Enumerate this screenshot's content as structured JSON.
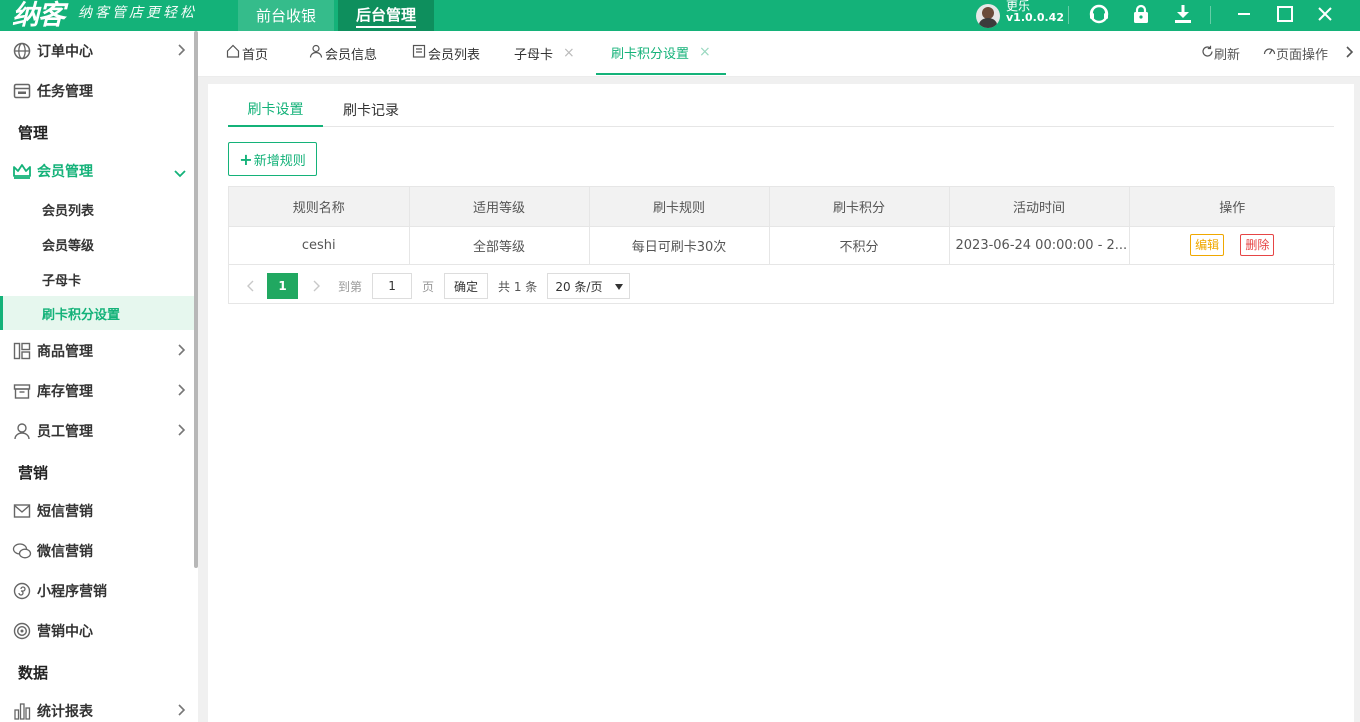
{
  "app": {
    "logo_text": "纳客",
    "slogan": "纳客管店更轻松",
    "top_nav": [
      {
        "label": "前台收银"
      },
      {
        "label": "后台管理"
      }
    ],
    "user": {
      "name": "更乐",
      "version": "v1.0.0.42"
    }
  },
  "sidebar": {
    "items": [
      {
        "label": "订单中心",
        "icon": "globe-icon"
      },
      {
        "label": "任务管理",
        "icon": "task-icon"
      },
      {
        "group": "管理"
      },
      {
        "label": "会员管理",
        "icon": "crown-icon"
      },
      {
        "label": "商品管理",
        "icon": "product-icon"
      },
      {
        "label": "库存管理",
        "icon": "inventory-icon"
      },
      {
        "label": "员工管理",
        "icon": "user-icon"
      },
      {
        "group": "营销"
      },
      {
        "label": "短信营销",
        "icon": "mail-icon"
      },
      {
        "label": "微信营销",
        "icon": "wechat-icon"
      },
      {
        "label": "小程序营销",
        "icon": "miniapp-icon"
      },
      {
        "label": "营销中心",
        "icon": "target-icon"
      },
      {
        "group": "数据"
      },
      {
        "label": "统计报表",
        "icon": "chart-icon"
      }
    ],
    "member_sub": [
      "会员列表",
      "会员等级",
      "子母卡",
      "刷卡积分设置"
    ]
  },
  "tabs": [
    {
      "label": "首页"
    },
    {
      "label": "会员信息"
    },
    {
      "label": "会员列表"
    },
    {
      "label": "子母卡"
    },
    {
      "label": "刷卡积分设置"
    }
  ],
  "tab_tools": {
    "refresh": "刷新",
    "page_ops": "页面操作"
  },
  "subtabs": [
    "刷卡设置",
    "刷卡记录"
  ],
  "add_button": "新增规则",
  "table": {
    "columns": [
      "规则名称",
      "适用等级",
      "刷卡规则",
      "刷卡积分",
      "活动时间",
      "操作"
    ],
    "rows": [
      {
        "name": "ceshi",
        "level": "全部等级",
        "rule": "每日可刷卡30次",
        "points": "不积分",
        "time": "2023-06-24 00:00:00 - 2...",
        "edit": "编辑",
        "delete": "删除"
      }
    ]
  },
  "pagination": {
    "current": "1",
    "goto_label": "到第",
    "page_value": "1",
    "page_suffix": "页",
    "confirm": "确定",
    "total": "共 1 条",
    "page_size": "20 条/页"
  },
  "colors": {
    "brand": "#14b279",
    "edit": "#f0a800",
    "delete": "#e64545"
  }
}
